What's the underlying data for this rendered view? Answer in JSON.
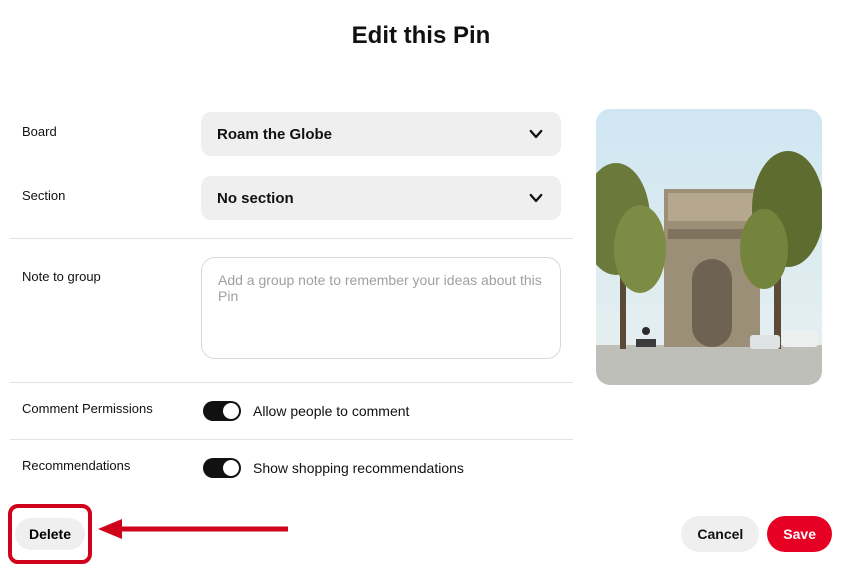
{
  "title": "Edit this Pin",
  "fields": {
    "board": {
      "label": "Board",
      "value": "Roam the Globe"
    },
    "section": {
      "label": "Section",
      "value": "No section"
    },
    "note": {
      "label": "Note to group",
      "placeholder": "Add a group note to remember your ideas about this Pin"
    },
    "comments": {
      "label": "Comment Permissions",
      "toggle_label": "Allow people to comment",
      "enabled": true
    },
    "recommendations": {
      "label": "Recommendations",
      "toggle_label": "Show shopping recommendations",
      "enabled": true
    }
  },
  "buttons": {
    "delete": "Delete",
    "cancel": "Cancel",
    "save": "Save"
  },
  "colors": {
    "primary": "#e60023",
    "highlight": "#d0021b"
  }
}
